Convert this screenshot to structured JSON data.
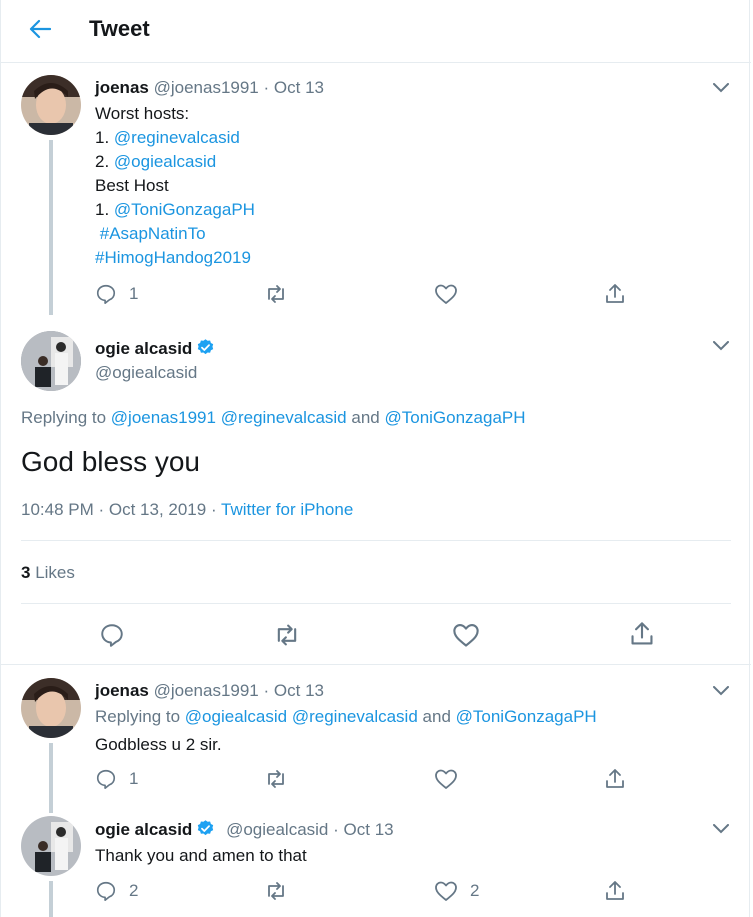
{
  "header": {
    "title": "Tweet"
  },
  "reply1": {
    "name": "joenas",
    "handle": "@joenas1991",
    "date": "Oct 13",
    "lines": [
      {
        "prefix": "Worst hosts:",
        "link": ""
      },
      {
        "prefix": "1. ",
        "link": "@reginevalcasid"
      },
      {
        "prefix": "2. ",
        "link": "@ogiealcasid"
      },
      {
        "prefix": "Best Host",
        "link": ""
      },
      {
        "prefix": "1. ",
        "link": "@ToniGonzagaPH"
      },
      {
        "prefix": " ",
        "link": "#AsapNatinTo"
      },
      {
        "prefix": "",
        "link": "#HimogHandog2019"
      }
    ],
    "reply_count": "1"
  },
  "main": {
    "name": "ogie alcasid",
    "handle": "@ogiealcasid",
    "replying_label": "Replying to",
    "replying_to": [
      "@joenas1991",
      "@reginevalcasid"
    ],
    "replying_and": "and",
    "replying_last": "@ToniGonzagaPH",
    "text": "God bless you",
    "timestamp": "10:48 PM · Oct 13, 2019 · ",
    "source": "Twitter for iPhone",
    "likes_count": "3",
    "likes_label": "Likes"
  },
  "reply2": {
    "name": "joenas",
    "handle": "@joenas1991",
    "date": "Oct 13",
    "replying_label": "Replying to",
    "replying_to": [
      "@ogiealcasid",
      "@reginevalcasid"
    ],
    "replying_and": "and",
    "replying_last": "@ToniGonzagaPH",
    "text": "Godbless u 2 sir.",
    "reply_count": "1"
  },
  "reply3": {
    "name": "ogie alcasid",
    "handle": "@ogiealcasid",
    "date": "Oct 13",
    "text": "Thank you and amen to that",
    "reply_count": "2",
    "like_count": "2"
  },
  "separator": "·",
  "colors": {
    "accent": "#1b95e0",
    "muted": "#657786",
    "verified": "#1da1f2"
  },
  "icons": [
    "back-arrow-icon",
    "chevron-down-icon",
    "reply-icon",
    "retweet-icon",
    "like-icon",
    "share-icon",
    "verified-icon"
  ]
}
